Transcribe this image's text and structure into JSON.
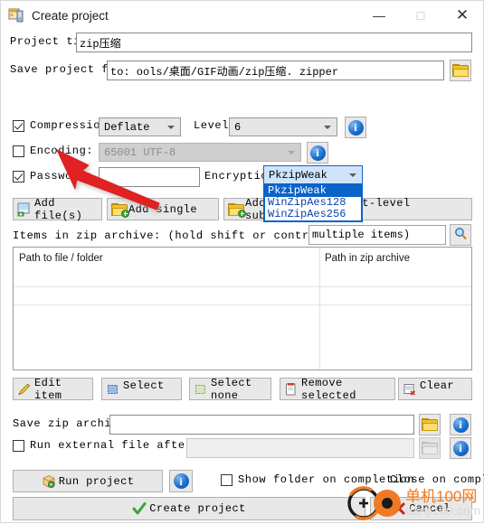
{
  "window": {
    "title": "Create project",
    "icon": "app-window-icon",
    "minimize": "—",
    "maximize": "□",
    "close": "✕"
  },
  "project_title": {
    "label": "Project tit",
    "value": "zip压缩"
  },
  "save_project_file": {
    "label": "Save project file",
    "value": "to: ools/桌面/GIF动画/zip压缩. zipper",
    "browse_icon": "folder-icon"
  },
  "compression": {
    "label": "Compression:",
    "checked": true,
    "value": "Deflate",
    "level_label": "Level:",
    "level_value": "6",
    "info_icon": "info-icon"
  },
  "encoding": {
    "label": "Encoding:",
    "checked": false,
    "value": "65001 UTF-8",
    "info_icon": "info-icon"
  },
  "password": {
    "label": "Password:",
    "checked": true,
    "value": "",
    "encryption_label": "Encryption:",
    "encryption_value": "PkzipWeak",
    "encryption_options": [
      "PkzipWeak",
      "WinZipAes128",
      "WinZipAes256"
    ],
    "encryption_selected_index": 0
  },
  "add_buttons": [
    {
      "label": "Add file(s)",
      "icon": "add-file-icon"
    },
    {
      "label": "Add single",
      "icon": "add-folder-icon"
    },
    {
      "label": "Add folder + first-level subfolders",
      "icon": "add-folder-icon"
    }
  ],
  "items_bar": {
    "label": "Items in zip archive: (hold shift or control to select",
    "filter_value": "multiple items)",
    "search_icon": "search-icon"
  },
  "list": {
    "columns": [
      "Path to file / folder",
      "Path in zip archive"
    ],
    "rows": []
  },
  "item_buttons": [
    {
      "label": "Edit item",
      "icon": "pencil-icon"
    },
    {
      "label": "Select",
      "icon": "select-all-icon"
    },
    {
      "label": "Select none",
      "icon": "select-none-icon"
    },
    {
      "label": "Remove selected",
      "icon": "remove-icon"
    },
    {
      "label": "Clear",
      "icon": "clear-icon"
    }
  ],
  "save_zip": {
    "label": "Save zip archive to:",
    "value": "",
    "browse_icon": "folder-icon",
    "info_icon": "info-icon"
  },
  "run_external": {
    "label": "Run external file after completion:",
    "checked": false,
    "value": "",
    "browse_icon": "folder-icon",
    "info_icon": "info-icon"
  },
  "footer": {
    "run_project": "Run project",
    "run_project_icon": "package-icon",
    "run_info_icon": "info-icon",
    "show_folder": "Show folder on completion",
    "show_folder_checked": false,
    "close_on_completion": "Close on completion",
    "close_on_completion_checked": false,
    "create_project": "Create project",
    "create_icon": "check-icon",
    "cancel": "Cancel",
    "cancel_icon": "cross-icon"
  },
  "watermark": {
    "cn": "单机100网",
    "en": "danji100.com"
  },
  "annotation": {
    "type": "red-arrow",
    "points_to": "password-checkbox"
  },
  "colors": {
    "accent_blue": "#0a64c8",
    "dropdown_text": "#0a3fb0",
    "button_face": "#e8e8e8",
    "watermark_orange": "#f07a22"
  }
}
